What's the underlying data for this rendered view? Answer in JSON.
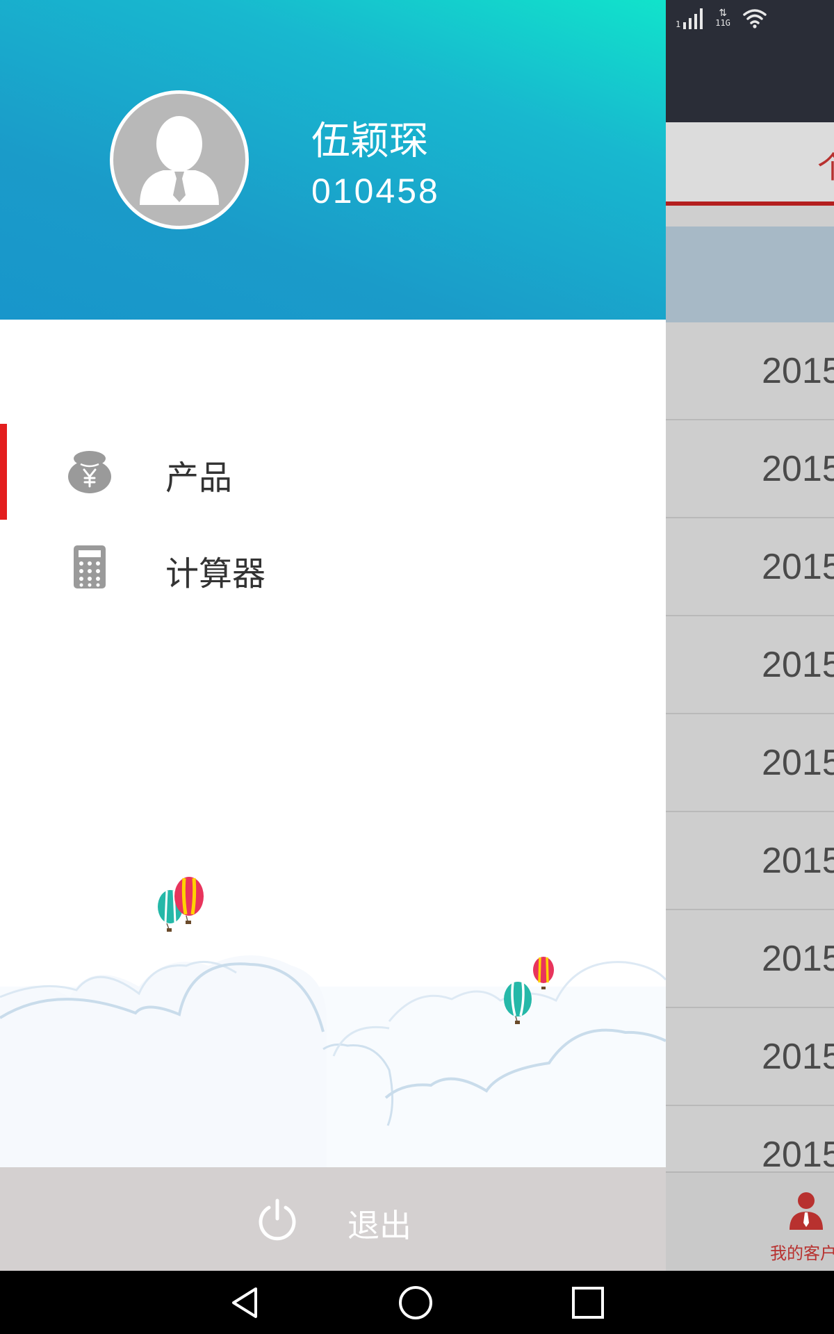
{
  "status_bar": {
    "signal_label": "1",
    "network_arrows": "⇅",
    "network_label": "11G",
    "icons": [
      "signal-icon",
      "network-icon",
      "wifi-icon"
    ]
  },
  "background_app": {
    "tab_label": "个",
    "rows": [
      "2015",
      "2015",
      "2015",
      "2015",
      "2015",
      "2015",
      "2015",
      "2015",
      "2015"
    ],
    "bottom_nav_label": "我的客户"
  },
  "drawer": {
    "user": {
      "name": "伍颖琛",
      "id": "010458"
    },
    "menu": [
      {
        "label": "产品",
        "icon": "money-bag-icon",
        "active": true
      },
      {
        "label": "计算器",
        "icon": "calculator-icon",
        "active": false
      }
    ],
    "logout_label": "退出"
  },
  "colors": {
    "header_gradient_top": "#11e3cb",
    "header_gradient_bottom": "#1896cb",
    "active_indicator": "#e31e1e",
    "accent_red": "#b8312f",
    "logout_bar": "#d4d0d0"
  },
  "system_nav": {
    "icons": [
      "back-icon",
      "home-icon",
      "recents-icon"
    ]
  }
}
